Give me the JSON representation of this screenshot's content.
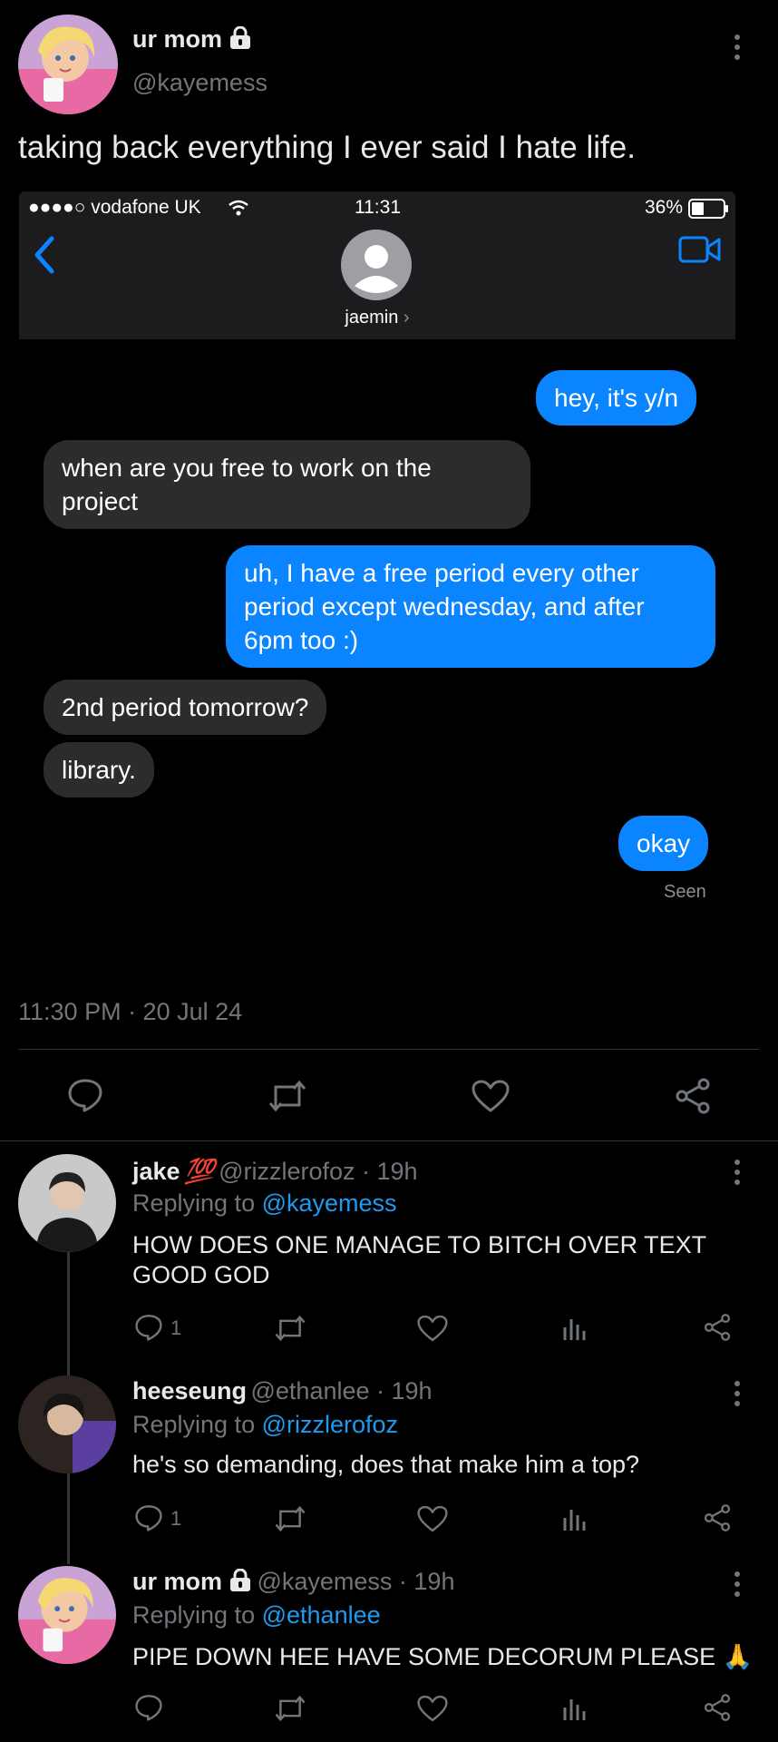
{
  "main_tweet": {
    "author_name": "ur mom",
    "author_handle": "@kayemess",
    "text": "taking back everything I ever said I hate life.",
    "timestamp": "11:30 PM · 20 Jul 24",
    "lock_icon": "lock-icon"
  },
  "screenshot": {
    "carrier": "●●●●○ vodafone UK",
    "time": "11:31",
    "battery": "36%",
    "contact_name": "jaemin",
    "messages": [
      {
        "from": "me",
        "text": "hey, it's y/n"
      },
      {
        "from": "them",
        "text": "when are you free to work on the project"
      },
      {
        "from": "me",
        "text": "uh, I have a free period every other period except wednesday, and after 6pm too :)"
      },
      {
        "from": "them",
        "text": "2nd period tomorrow?"
      },
      {
        "from": "them",
        "text": "library."
      },
      {
        "from": "me",
        "text": "okay"
      }
    ],
    "seen_label": "Seen"
  },
  "replies": [
    {
      "name": "jake",
      "badge": "💯",
      "handle": "@rizzlerofoz · 19h",
      "replying_prefix": "Replying to",
      "replying_to": "@kayemess",
      "text": "HOW DOES ONE MANAGE TO BITCH OVER TEXT GOOD GOD",
      "reply_count": "1"
    },
    {
      "name": "heeseung",
      "handle": "@ethanlee · 19h",
      "replying_prefix": "Replying to",
      "replying_to": "@rizzlerofoz",
      "text": "he's so demanding, does that make him a top?",
      "reply_count": "1"
    },
    {
      "name": "ur mom",
      "handle": "@kayemess · 19h",
      "replying_prefix": "Replying to",
      "replying_to": "@ethanlee",
      "text": "PIPE DOWN HEE HAVE SOME DECORUM PLEASE",
      "emoji": "🙏"
    }
  ],
  "colors": {
    "background": "#000000",
    "accent": "#1d9bf0",
    "imessage_blue": "#0a84ff",
    "imessage_gray": "#2c2c2e",
    "secondary_text": "#71767b"
  }
}
